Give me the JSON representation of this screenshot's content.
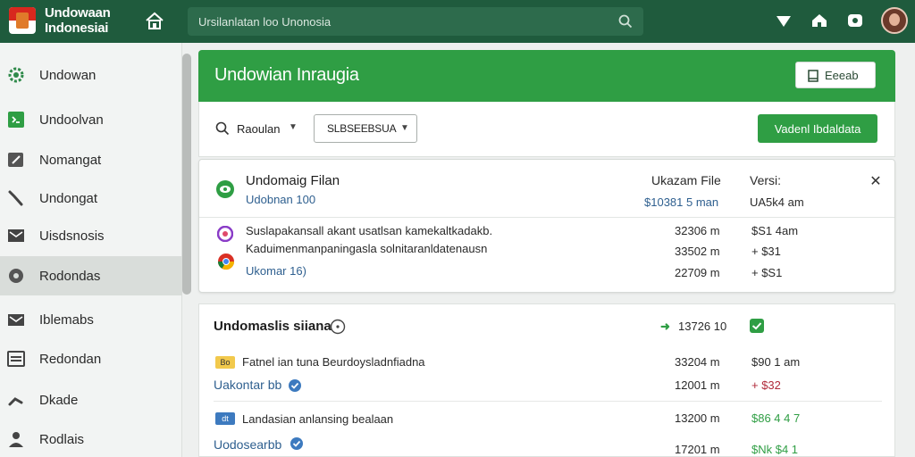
{
  "app": {
    "brand_line1": "Undowaan",
    "brand_line2": "Indonesiai"
  },
  "search": {
    "placeholder": "Ursilanlatan loo Unonosia"
  },
  "sidebar": {
    "items": [
      {
        "label": "Undowan",
        "icon": "gear-icon"
      },
      {
        "label": "Undoolvan",
        "icon": "code-icon"
      },
      {
        "label": "Nomangat",
        "icon": "edit-icon"
      },
      {
        "label": "Undongat",
        "icon": "wrench-icon"
      },
      {
        "label": "Uisdsnosis",
        "icon": "mail-icon"
      },
      {
        "label": "Rodondas",
        "icon": "gear-icon",
        "active": true
      },
      {
        "label": "Iblemabs",
        "icon": "mail-icon"
      },
      {
        "label": "Redondan",
        "icon": "list-icon"
      },
      {
        "label": "Dkade",
        "icon": "wrench-icon"
      },
      {
        "label": "Rodlais",
        "icon": "person-icon"
      }
    ]
  },
  "hero": {
    "title": "Undowian Inraugia",
    "button_label": "Eeeab"
  },
  "filters": {
    "search_label": "Raoulan",
    "select_value": "SLBSEEBSUA",
    "action_button": "Vadenl Ibdaldata"
  },
  "card": {
    "title": "Undomaig Filan",
    "subtitle": "Udobnan 100",
    "col1_header": "Ukazam File",
    "col2_header": "Versi:",
    "col1_value": "$10381 5 man",
    "col2_value": "UA5k4 am",
    "desc_line1": "Suslapakansall akant usatlsan kamekaltkadakb.",
    "desc_line2": "Kaduimenmanpaningasla solnitaranldatenausn",
    "rows": [
      {
        "size": "32306 m",
        "value": "$S1 4am"
      },
      {
        "size": "33502 m",
        "value": "+ $31"
      },
      {
        "label": "Ukomar 16)",
        "size": "22709 m",
        "value": "+ $S1"
      }
    ]
  },
  "section": {
    "title": "Undomaslis siiana",
    "summary_value": "13726 10",
    "rows": [
      {
        "tag": "Bo",
        "text": "Fatnel ian tuna Beurdoysladnfiadna",
        "size": "33204 m",
        "value": "$90 1 am"
      },
      {
        "link": "Uakontar bb",
        "size": "12001 m",
        "value": "+ $32"
      },
      {
        "tag": "dt",
        "text": "Landasian anlansing bealaan",
        "size": "13200 m",
        "value": "$86 4 4 7"
      },
      {
        "link": "Uodosearbb",
        "size": "17201 m",
        "value": "$Nk $4 1"
      }
    ]
  },
  "colors": {
    "topbar": "#1f5b3d",
    "primary_green": "#2f9e44",
    "link_blue": "#2e5f8f",
    "negative_red": "#b02a3a"
  }
}
